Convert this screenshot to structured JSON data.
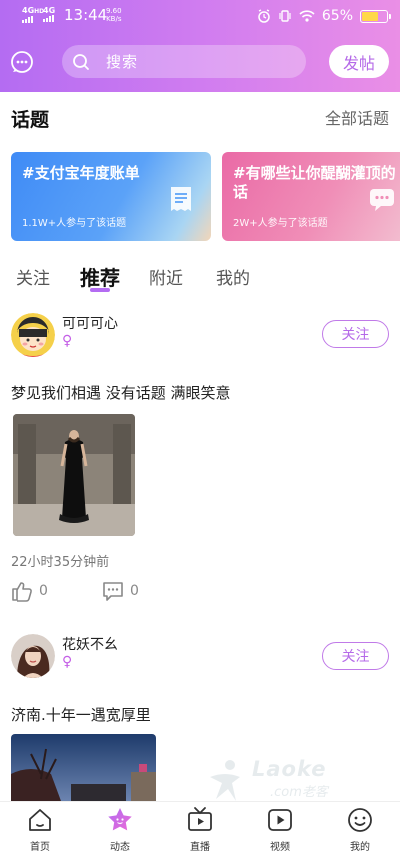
{
  "status_bar": {
    "signal1": "4G",
    "signal1_sup": "HD",
    "signal2": "4G",
    "time": "13:44",
    "speed_value": "9.60",
    "speed_unit": "KB/s",
    "battery_percent": "65%",
    "battery_level": 0.65
  },
  "header": {
    "message_icon": "chat-bubble-icon",
    "search_placeholder": "搜索",
    "post_button": "发帖"
  },
  "topics": {
    "title": "话题",
    "all_link": "全部话题",
    "cards": [
      {
        "name": "#支付宝年度账单",
        "count": "1.1W+人参与了该话题",
        "icon": "document-icon"
      },
      {
        "name": "#有哪些让你醍醐灌顶的话",
        "count": "2W+人参与了该话题",
        "icon": "chat-icon"
      }
    ]
  },
  "tabs": {
    "items": [
      "关注",
      "推荐",
      "附近",
      "我的"
    ],
    "active": "推荐"
  },
  "feed": {
    "posts": [
      {
        "username": "可可可心",
        "gender_symbol": "♀",
        "follow_label": "关注",
        "text": "梦见我们相遇  没有话题 满眼笑意",
        "time_ago": "22小时35分钟前",
        "likes": "0",
        "comments": "0"
      },
      {
        "username": "花妖不幺",
        "gender_symbol": "♀",
        "follow_label": "关注",
        "text": "济南.十年一遇宽厚里"
      }
    ]
  },
  "watermark": {
    "brand": "Laoke",
    "domain": ".com老客"
  },
  "bottom_nav": {
    "items": [
      {
        "label": "首页",
        "icon": "home-icon"
      },
      {
        "label": "动态",
        "icon": "star-icon"
      },
      {
        "label": "直播",
        "icon": "tv-icon"
      },
      {
        "label": "视频",
        "icon": "play-icon"
      },
      {
        "label": "我的",
        "icon": "smiley-icon"
      }
    ],
    "active": "动态"
  },
  "colors": {
    "accent": "#b46cf2",
    "accent_gradient_end": "#ea8fe6"
  }
}
